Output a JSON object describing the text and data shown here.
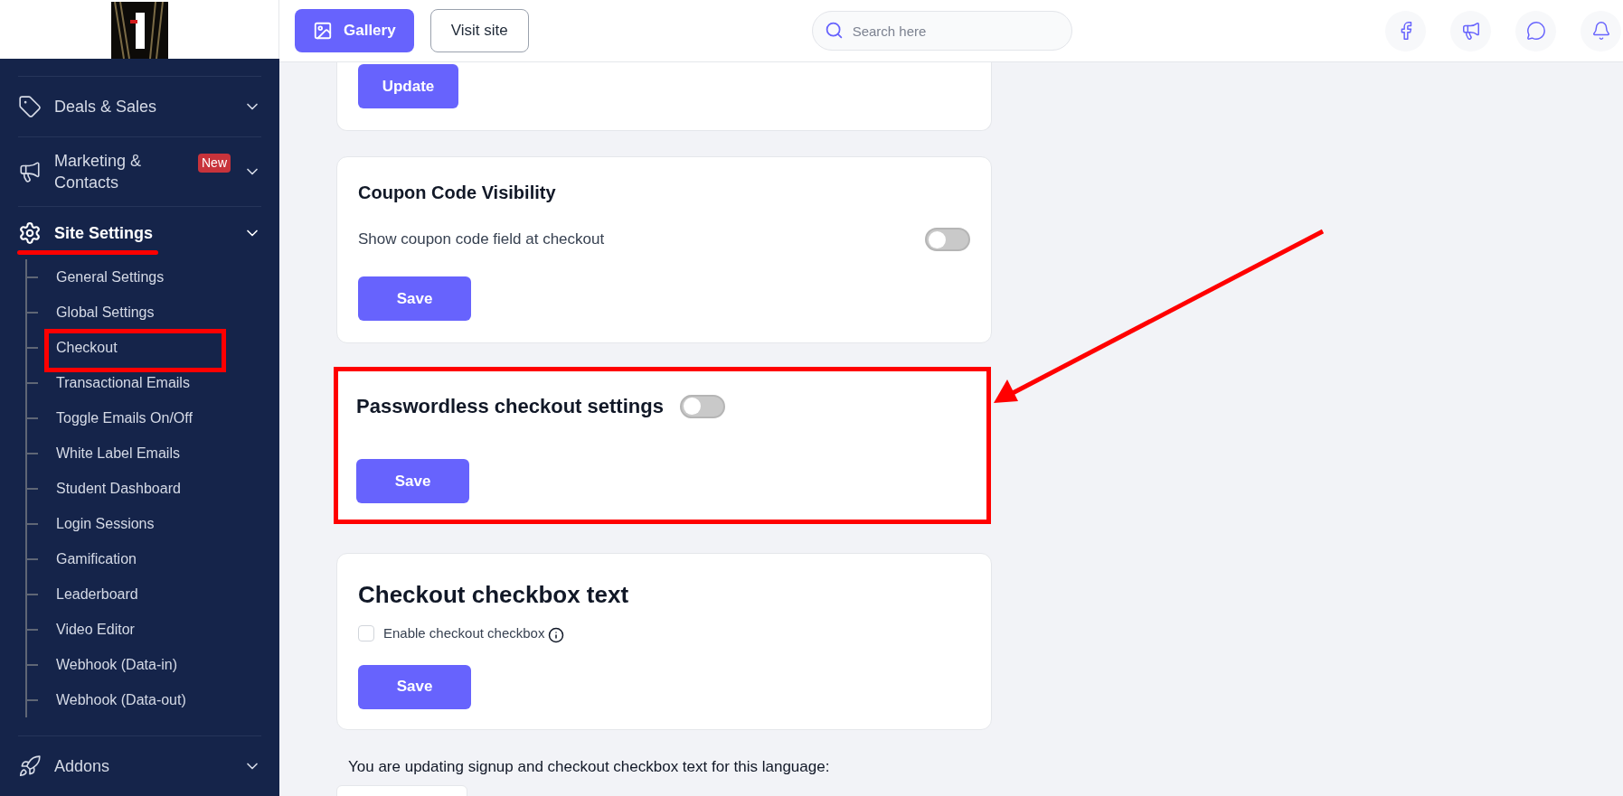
{
  "header": {
    "gallery_button": "Gallery",
    "visit_site_button": "Visit site",
    "search": {
      "placeholder": "Search here"
    }
  },
  "sidebar": {
    "items": [
      {
        "kind": "deals",
        "label": "Deals & Sales",
        "selected": false
      },
      {
        "kind": "marketing",
        "label": "Marketing & Contacts",
        "badge": "New",
        "selected": false
      },
      {
        "kind": "settings",
        "label": "Site Settings",
        "selected": true,
        "children": [
          {
            "label": "General Settings"
          },
          {
            "label": "Global Settings"
          },
          {
            "label": "Checkout"
          },
          {
            "label": "Transactional Emails"
          },
          {
            "label": "Toggle Emails On/Off"
          },
          {
            "label": "White Label Emails"
          },
          {
            "label": "Student Dashboard"
          },
          {
            "label": "Login Sessions"
          },
          {
            "label": "Gamification"
          },
          {
            "label": "Leaderboard"
          },
          {
            "label": "Video Editor"
          },
          {
            "label": "Webhook (Data-in)"
          },
          {
            "label": "Webhook (Data-out)"
          }
        ]
      },
      {
        "kind": "addons",
        "label": "Addons",
        "selected": false
      }
    ]
  },
  "update_card": {
    "button": "Update"
  },
  "coupon_card": {
    "title": "Coupon Code Visibility",
    "setting": "Show coupon code field at checkout",
    "toggle": {
      "on": false
    },
    "button": "Save"
  },
  "passwordless_card": {
    "title": "Passwordless checkout settings",
    "toggle": {
      "on": false
    },
    "button": "Save"
  },
  "checkbox_card": {
    "title": "Checkout checkbox text",
    "checkbox": {
      "label": "Enable checkout checkbox",
      "checked": false
    },
    "button": "Save"
  },
  "language_note": "You are updating signup and checkout checkbox text for this language:"
}
